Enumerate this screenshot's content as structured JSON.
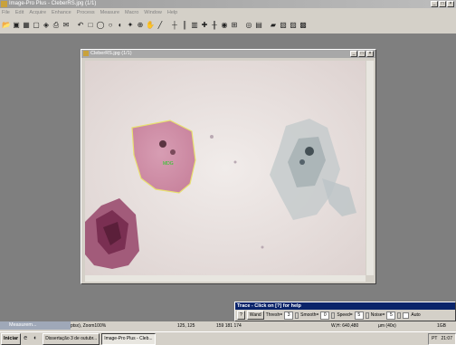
{
  "app": {
    "title": "Image-Pro Plus - CleberRS.jpg (1/1)"
  },
  "menu": [
    "File",
    "Edit",
    "Acquire",
    "Enhance",
    "Process",
    "Measure",
    "Macro",
    "Window",
    "Help"
  ],
  "toolbar_icons": [
    "open",
    "save",
    "grid",
    "new",
    "layers",
    "print",
    "mail",
    "undo",
    "rect",
    "ellipse",
    "circle",
    "paint",
    "wand",
    "magnify",
    "hand",
    "line",
    "profile",
    "bars",
    "histo",
    "cross",
    "align",
    "eye",
    "measure",
    "zoom",
    "layout",
    "chart",
    "export",
    "stack",
    "stack2"
  ],
  "doc_window": {
    "title": "CleberRS.jpg (1/1)",
    "cell_label": "MDG"
  },
  "trace_panel": {
    "title": "Trace - Click on [?] for help",
    "help_label": "?",
    "wand_label": "Wand",
    "thresh_label": "Thresh=",
    "thresh_value": "3",
    "smooth_label": "Smooth=",
    "smooth_value": "0",
    "speed_label": "Speed=",
    "speed_value": "5",
    "noise_label": "Noise=",
    "noise_value": "5",
    "auto_label": "Auto"
  },
  "measurements_window": {
    "title": "Measurem..."
  },
  "status_bar": {
    "zoom": "ptsx), Zoom100%",
    "coords": "125, 125",
    "rgb": "159 181 174",
    "size": "W,H: 640,480",
    "units": "µm (40x)",
    "bits": "1GB"
  },
  "taskbar": {
    "start_label": "Iniciar",
    "tasks": [
      "Dissertação 3 de outubr...",
      "Image-Pro Plus - Cleb..."
    ],
    "tray_lang": "PT",
    "clock": "21:07"
  },
  "colors": {
    "desktop": "#7f7f7f",
    "chrome": "#d4d0c8",
    "active_title": "#0a246a",
    "cell_outline": "#e8e070",
    "cell_label": "#22cc22"
  }
}
